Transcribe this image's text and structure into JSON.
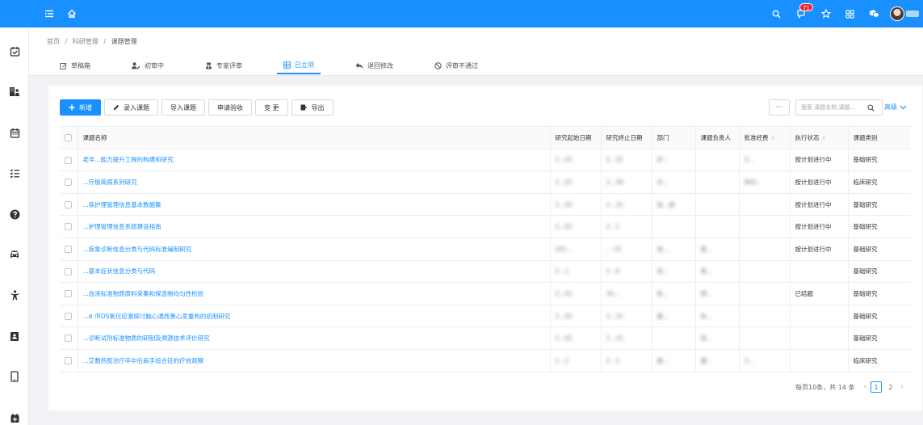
{
  "topbar": {
    "notification_count": "71",
    "colors": {
      "primary": "#1890ff",
      "badge": "#f5222d"
    }
  },
  "breadcrumb": [
    "首页",
    "/",
    "科研管理",
    "/",
    "课题管理"
  ],
  "tabs": [
    {
      "label": "草稿箱",
      "icon": "edit-icon"
    },
    {
      "label": "初审中",
      "icon": "user-edit-icon"
    },
    {
      "label": "专家评审",
      "icon": "expert-icon"
    },
    {
      "label": "已立项",
      "icon": "table-icon",
      "active": true
    },
    {
      "label": "退回修改",
      "icon": "reply-icon"
    },
    {
      "label": "评审不通过",
      "icon": "ban-icon"
    }
  ],
  "toolbar": {
    "add_label": "新增",
    "enter_label": "录入课题",
    "import_label": "导入课题",
    "acceptance_label": "申请验收",
    "change_label": "变 更",
    "export_label": "导出",
    "more_label": "···",
    "search_placeholder": "搜索 课题名称,课题...",
    "advanced_label": "高级"
  },
  "table": {
    "headers": [
      "课题名称",
      "研究起始日期",
      "研究终止日期",
      "部门",
      "课题负责人",
      "批准经费",
      "执行状态",
      "课题类别"
    ],
    "rows": [
      {
        "name": "老年...能力提升工程的构建和研究",
        "start": "2...01",
        "end": "2...31",
        "dept": "护...",
        "owner": "",
        "funding": "3...",
        "status": "按计划进行中",
        "category": "基础研究"
      },
      {
        "name": "...疗极简病系列研究",
        "start": "2...01",
        "end": "2...30",
        "dept": "丰...",
        "owner": "",
        "funding": "800...",
        "status": "按计划进行中",
        "category": "临床研究"
      },
      {
        "name": "...疾护理管理信息基本数据集",
        "start": "2...01",
        "end": "2...31",
        "dept": "信...部",
        "owner": "",
        "funding": "",
        "status": "按计划进行中",
        "category": "基础研究"
      },
      {
        "name": "...护理管理信息系统建设指南",
        "start": "2...01",
        "end": "2...1",
        "dept": "",
        "owner": "",
        "funding": "",
        "status": "按计划进行中",
        "category": "基础研究"
      },
      {
        "name": "...疾象诊断信息分类与代码标准编制研究",
        "start": "201...",
        "end": "...-31",
        "dept": "信...",
        "owner": "易...",
        "funding": "",
        "status": "按计划进行中",
        "category": "基础研究"
      },
      {
        "name": "...基本症状信息分类与代码",
        "start": "2...1",
        "end": "2...0",
        "dept": "信...",
        "owner": "易...",
        "funding": "",
        "status": "",
        "category": "基础研究"
      },
      {
        "name": "...血液标准物质原料采集和保选物均匀性检验",
        "start": "2...01",
        "end": "20...",
        "dept": "检...",
        "owner": "郝...",
        "funding": "",
        "status": "已结题",
        "category": "基础研究"
      },
      {
        "name": "...α /ROS氧化应激探讨脑心通改善心室重构的机制研究",
        "start": "2...01",
        "end": "2...31",
        "dept": "惠...",
        "owner": "朱...",
        "funding": "",
        "status": "",
        "category": "基础研究"
      },
      {
        "name": "...诊断试剂标准物质的研制及溯源技术评价研究",
        "start": "2...01",
        "end": "2...31",
        "dept": "",
        "owner": "张...",
        "funding": "",
        "status": "",
        "category": "基础研究"
      },
      {
        "name": "...艾敷热熨治疗卒中后肩手综合征的疗效观察",
        "start": "2...1",
        "end": "2...1",
        "dept": "康...",
        "owner": "雷...",
        "funding": "3...",
        "status": "",
        "category": "临床研究"
      }
    ]
  },
  "pagination": {
    "summary": "每页10条，共 14 条",
    "pages": [
      "1",
      "2"
    ],
    "current": "1",
    "prev": "‹",
    "next": "›"
  }
}
